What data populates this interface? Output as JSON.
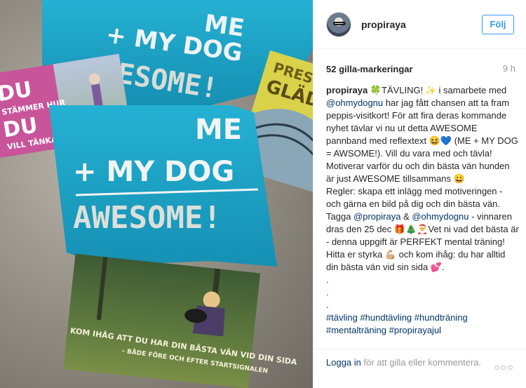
{
  "post": {
    "username": "propiraya",
    "follow_label": "Följ",
    "likes": "52 gilla-markeringar",
    "time": "9 h"
  },
  "caption": {
    "username": "propiraya",
    "t1": " 🍀TÄVLING! ",
    "t2": " i samarbete med ",
    "mention1": "@ohmydognu",
    "t3": " har jag fått chansen att ta fram peppis-visitkort! För att fira deras kommande nyhet tävlar vi nu ut detta AWESOME pannband med reflextext 😆💙 (ME + MY DOG = AWSOME!). Vill du vara med och tävla! Motiverar varför du och din bästa vän hunden är just AWESOME tillsammans 😀",
    "t4": "Regler: skapa ett inlägg med motiveringen - och gärna en bild på dig och din bästa vän. Tagga ",
    "mention2": "@propiraya",
    "t5": " & ",
    "mention3": "@ohmydognu",
    "t6": " - vinnaren dras den 25 dec 🎁🎄🎅Vet ni vad det bästa är - denna uppgift är PERFEKT mental träning! Hitta er styrka 💪🏼 och kom ihåg: du har alltid din bästa vän vid sin sida 💕.",
    "dot1": ".",
    "dot2": ".",
    "dot3": ".",
    "hashtags": [
      "#tävling",
      "#hundtävling",
      "#hundträning",
      "#mentalträning",
      "#propirayajul"
    ]
  },
  "photo": {
    "band_top": [
      "ME",
      "+ MY DOG",
      "AWESOME!"
    ],
    "band_main": [
      "ME",
      "+ MY DOG",
      "AWESOME!"
    ],
    "card_left": [
      "DU",
      "STÄMMER HUR",
      "DU",
      "VILL TÄNKA"
    ],
    "card_right": [
      "PRES",
      "GLÄD"
    ],
    "card_bottom": [
      "KOM IHÅG ATT DU HAR DIN BÄSTA VÄN VID DIN SIDA",
      "– BÅDE FÖRE OCH EFTER STARTSIGNALEN"
    ]
  },
  "footer": {
    "login_link": "Logga in",
    "login_rest": " för att gilla eller kommentera.",
    "more": "○○○"
  },
  "colors": {
    "accent": "#3897f0",
    "link": "#003569",
    "band": "#1ea3c6"
  }
}
